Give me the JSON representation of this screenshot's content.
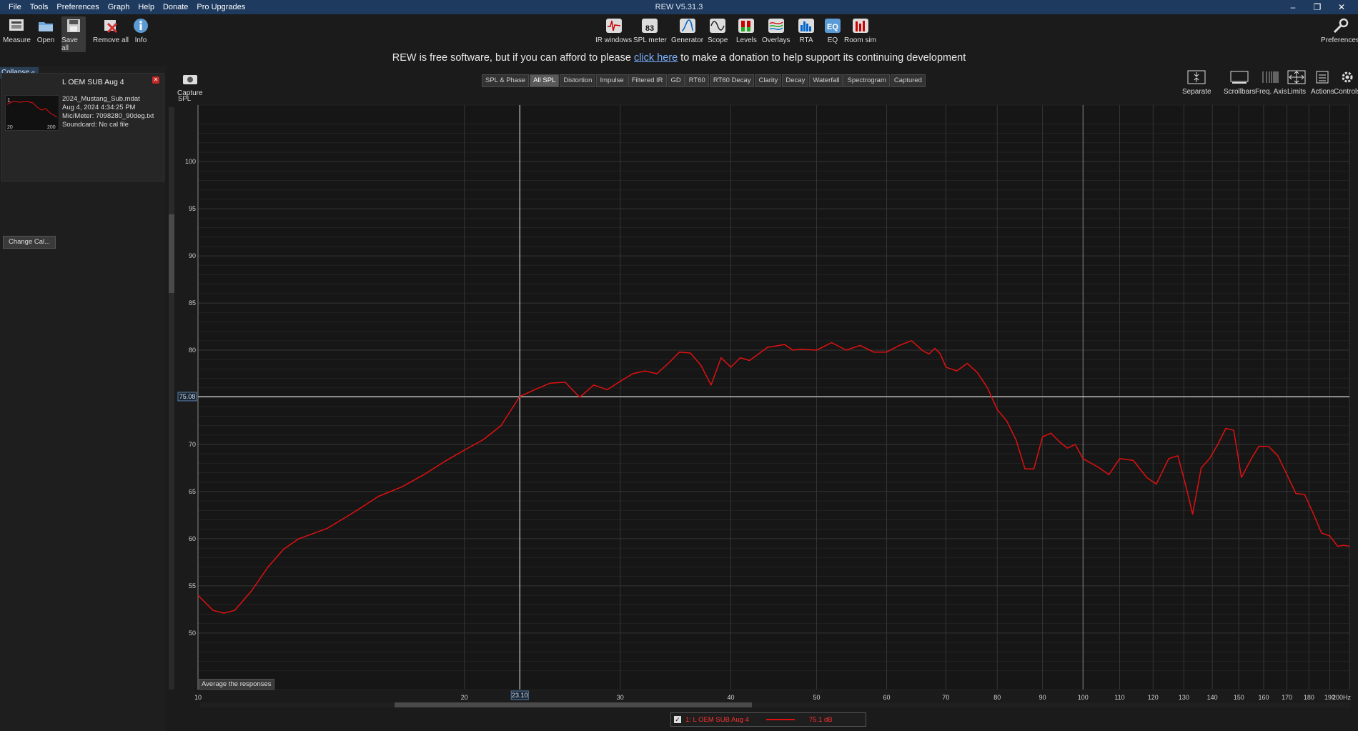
{
  "window": {
    "title": "REW V5.31.3",
    "menu": [
      "File",
      "Tools",
      "Preferences",
      "Graph",
      "Help",
      "Donate",
      "Pro Upgrades"
    ]
  },
  "toolbar": {
    "left": [
      {
        "label": "Measure",
        "icon": "measure-icon"
      },
      {
        "label": "Open",
        "icon": "open-folder-icon"
      },
      {
        "label": "Save all",
        "icon": "save-all-icon"
      },
      {
        "label": "Remove all",
        "icon": "remove-all-icon"
      },
      {
        "label": "Info",
        "icon": "info-icon"
      }
    ],
    "center": [
      {
        "label": "IR windows",
        "icon": "ir-windows-icon"
      },
      {
        "label": "SPL meter",
        "icon": "spl-meter-icon",
        "badge": "83"
      },
      {
        "label": "Generator",
        "icon": "generator-icon"
      },
      {
        "label": "Scope",
        "icon": "scope-icon"
      },
      {
        "label": "Levels",
        "icon": "levels-icon"
      },
      {
        "label": "Overlays",
        "icon": "overlays-icon"
      },
      {
        "label": "RTA",
        "icon": "rta-icon"
      },
      {
        "label": "EQ",
        "icon": "eq-icon"
      },
      {
        "label": "Room sim",
        "icon": "room-sim-icon"
      }
    ],
    "right": {
      "label": "Preferences",
      "icon": "wrench-icon"
    }
  },
  "donate": {
    "before": "REW is free software, but if you can afford to please ",
    "link": "click here",
    "after": " to make a donation to help support its continuing development"
  },
  "left_panel": {
    "collapse_label": "Collapse",
    "measurement": {
      "title": "L OEM SUB Aug 4",
      "file": "2024_Mustang_Sub.mdat",
      "date": "Aug 4, 2024 4:34:25 PM",
      "mic": "Mic/Meter: 7098280_90deg.txt",
      "soundcard": "Soundcard: No cal file",
      "thumb_index": "1",
      "thumb_x0": "20",
      "thumb_x1": "200"
    },
    "change_cal": "Change Cal..."
  },
  "capture": {
    "label": "Capture",
    "icon": "camera-icon"
  },
  "graph_tabs": [
    "SPL & Phase",
    "All SPL",
    "Distortion",
    "Impulse",
    "Filtered IR",
    "GD",
    "RT60",
    "RT60 Decay",
    "Clarity",
    "Decay",
    "Waterfall",
    "Spectrogram",
    "Captured"
  ],
  "graph_tab_selected": "All SPL",
  "right_controls": [
    {
      "label": "Separate",
      "icon": "separate-icon"
    },
    {
      "label": "Scrollbars",
      "icon": "scrollbars-icon"
    },
    {
      "label": "Freq. Axis",
      "icon": "freq-axis-icon"
    },
    {
      "label": "Limits",
      "icon": "limits-icon"
    },
    {
      "label": "Actions",
      "icon": "actions-icon"
    },
    {
      "label": "Controls",
      "icon": "controls-icon"
    }
  ],
  "avg_button": "Average the responses",
  "cursor": {
    "x_label": "23.10",
    "y_label": "75.08",
    "x": 23.1,
    "y": 75.08
  },
  "legend": {
    "checked": true,
    "name": "1: L OEM SUB Aug 4",
    "value": "75.1 dB",
    "color": "#e01010"
  },
  "chart_data": {
    "type": "line",
    "ylabel": "SPL",
    "x_scale": "log",
    "xlim": [
      10,
      200
    ],
    "ylim": [
      44,
      106
    ],
    "x_ticks": [
      10,
      20,
      30,
      40,
      50,
      60,
      70,
      80,
      90,
      100,
      110,
      120,
      130,
      140,
      150,
      160,
      170,
      180,
      190,
      200
    ],
    "x_tick_labels": [
      "10",
      "20",
      "30",
      "40",
      "50",
      "60",
      "70",
      "80",
      "90",
      "100",
      "110",
      "120",
      "130",
      "140",
      "150",
      "160",
      "170",
      "180",
      "190",
      "200Hz"
    ],
    "y_ticks": [
      50,
      55,
      60,
      65,
      70,
      75,
      80,
      85,
      90,
      95,
      100
    ],
    "grid": true,
    "series": [
      {
        "name": "1: L OEM SUB Aug 4",
        "color": "#e01010",
        "x": [
          10,
          10.4,
          10.7,
          11.0,
          11.5,
          12.0,
          12.5,
          13.0,
          14.0,
          15.0,
          16.0,
          17.0,
          18.0,
          19.0,
          20.0,
          21.0,
          22.0,
          23.1,
          24.0,
          25.0,
          26.0,
          27.0,
          28.0,
          29.0,
          30.0,
          31.0,
          32.0,
          33.0,
          34.0,
          35.0,
          36.0,
          37.0,
          38.0,
          39.0,
          40.0,
          41.0,
          42.0,
          44.0,
          46.0,
          47.0,
          48.0,
          50.0,
          52.0,
          54.0,
          56.0,
          58.0,
          60.0,
          62.0,
          64.0,
          66.0,
          67.0,
          68.0,
          69.0,
          70.0,
          72.0,
          74.0,
          76.0,
          78.0,
          80.0,
          82.0,
          84.0,
          86.0,
          88.0,
          90.0,
          92.0,
          94.0,
          96.0,
          98.0,
          100.0,
          104.0,
          107.0,
          110.0,
          114.0,
          118.0,
          121.0,
          125.0,
          128.0,
          131.0,
          133.0,
          136.0,
          139.0,
          142.0,
          145.0,
          148.0,
          151.0,
          155.0,
          158.0,
          162.0,
          166.0,
          170.0,
          174.0,
          178.0,
          182.0,
          186.0,
          190.0,
          194.0,
          197.0,
          200.0
        ],
        "y": [
          54.0,
          52.4,
          52.1,
          52.4,
          54.5,
          57.0,
          58.9,
          60.0,
          61.1,
          62.8,
          64.5,
          65.5,
          66.8,
          68.2,
          69.4,
          70.5,
          72.0,
          75.08,
          75.8,
          76.5,
          76.6,
          75.0,
          76.3,
          75.8,
          76.7,
          77.5,
          77.8,
          77.5,
          78.6,
          79.8,
          79.7,
          78.4,
          76.3,
          79.2,
          78.2,
          79.2,
          78.9,
          80.3,
          80.6,
          80.0,
          80.1,
          80.0,
          80.8,
          80.0,
          80.5,
          79.8,
          79.8,
          80.5,
          81.0,
          79.9,
          79.6,
          80.2,
          79.6,
          78.2,
          77.8,
          78.6,
          77.6,
          76.0,
          73.7,
          72.5,
          70.5,
          67.4,
          67.4,
          70.8,
          71.2,
          70.3,
          69.6,
          70.0,
          68.5,
          67.6,
          66.8,
          68.5,
          68.3,
          66.5,
          65.8,
          68.5,
          68.8,
          65.2,
          62.6,
          67.5,
          68.5,
          70.0,
          71.7,
          71.5,
          66.5,
          68.5,
          69.8,
          69.8,
          68.8,
          66.8,
          64.8,
          64.7,
          62.7,
          60.6,
          60.3,
          59.2,
          59.3,
          59.2
        ]
      }
    ]
  }
}
